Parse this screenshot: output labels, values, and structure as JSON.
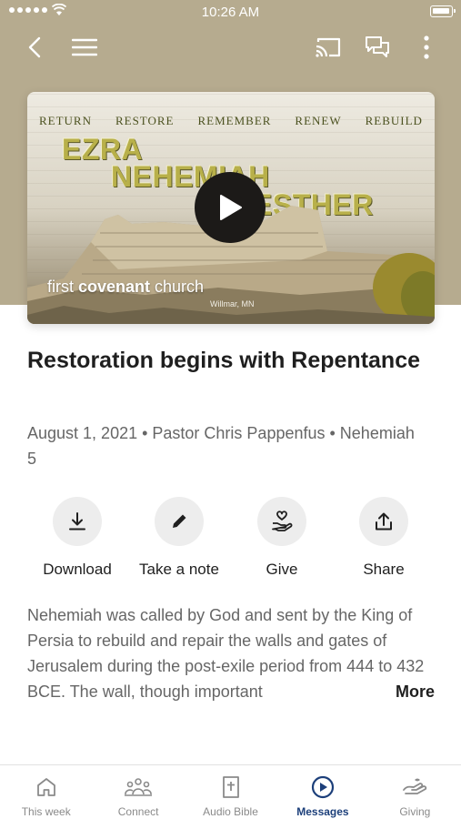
{
  "status_bar": {
    "time": "10:26 AM"
  },
  "nav": {
    "back_icon": "chevron-left-icon",
    "menu_icon": "hamburger-icon",
    "cast_icon": "cast-icon",
    "chat_icon": "chat-icon",
    "more_icon": "more-vertical-icon"
  },
  "artwork": {
    "themes": [
      "RETURN",
      "RESTORE",
      "REMEMBER",
      "RENEW",
      "REBUILD"
    ],
    "books": [
      "EZRA",
      "NEHEMIAH",
      "ESTHER"
    ],
    "church_light": "first ",
    "church_bold": "covenant",
    "church_rest": " church",
    "city": "Willmar, MN"
  },
  "message": {
    "title": "Restoration begins with Repentance",
    "meta": "August 1, 2021 • Pastor Chris Pappenfus • Nehemiah 5",
    "description": "Nehemiah was called by God and sent by the King of Persia to rebuild and repair the walls and gates of Jerusalem during the post-exile period from 444 to 432 BCE.  The wall, though important",
    "more_label": "More"
  },
  "actions": [
    {
      "label": "Download",
      "icon": "download-icon"
    },
    {
      "label": "Take a note",
      "icon": "pencil-icon"
    },
    {
      "label": "Give",
      "icon": "heart-hand-icon"
    },
    {
      "label": "Share",
      "icon": "share-icon"
    }
  ],
  "tabs": [
    {
      "label": "This week",
      "icon": "home-icon",
      "active": false
    },
    {
      "label": "Connect",
      "icon": "people-icon",
      "active": false
    },
    {
      "label": "Audio Bible",
      "icon": "bible-icon",
      "active": false
    },
    {
      "label": "Messages",
      "icon": "play-circle-icon",
      "active": true
    },
    {
      "label": "Giving",
      "icon": "giving-hand-icon",
      "active": false
    }
  ],
  "colors": {
    "hero_bg": "#b6ab8f",
    "accent": "#1c3f7a",
    "inactive": "#8a8a8a"
  }
}
